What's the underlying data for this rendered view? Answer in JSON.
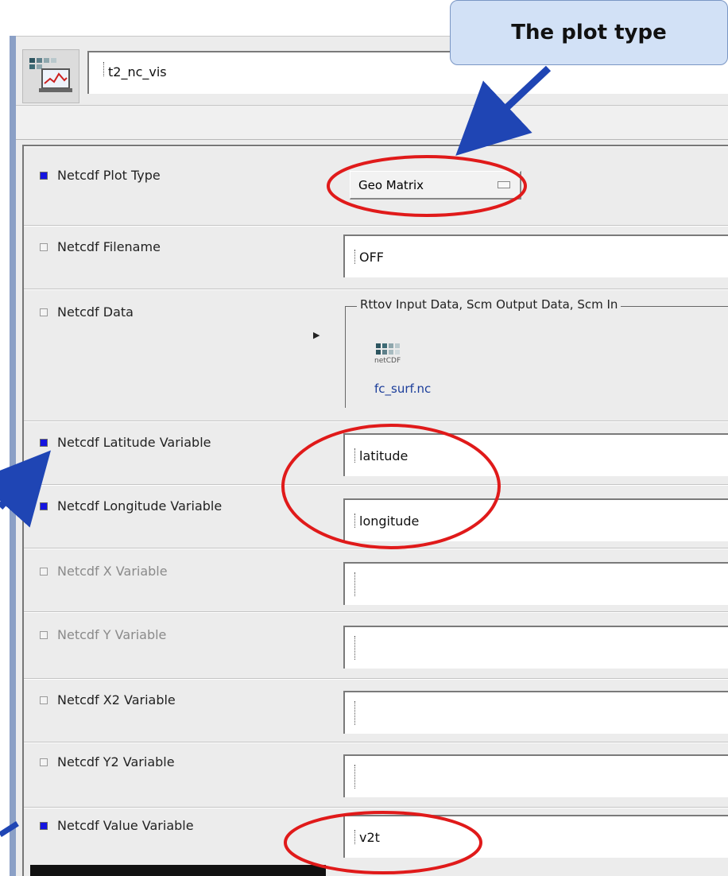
{
  "callout": {
    "text": "The plot type"
  },
  "header": {
    "name": "t2_nc_vis"
  },
  "data_box": {
    "legend": "Rttov Input Data, Scm Output Data, Scm In",
    "icon_label": "netCDF",
    "file": "fc_surf.nc"
  },
  "plot_type": {
    "value": "Geo Matrix"
  },
  "rows": [
    {
      "label": "Netcdf Plot Type",
      "checked": true,
      "enabled": true
    },
    {
      "label": "Netcdf Filename",
      "checked": false,
      "enabled": true,
      "value": "OFF"
    },
    {
      "label": "Netcdf Data",
      "checked": false,
      "enabled": true
    },
    {
      "label": "Netcdf Latitude Variable",
      "checked": true,
      "enabled": true,
      "value": "latitude"
    },
    {
      "label": "Netcdf Longitude Variable",
      "checked": true,
      "enabled": true,
      "value": "longitude"
    },
    {
      "label": "Netcdf X Variable",
      "checked": false,
      "enabled": false,
      "value": ""
    },
    {
      "label": "Netcdf Y Variable",
      "checked": false,
      "enabled": false,
      "value": ""
    },
    {
      "label": "Netcdf X2 Variable",
      "checked": false,
      "enabled": true,
      "value": ""
    },
    {
      "label": "Netcdf Y2 Variable",
      "checked": false,
      "enabled": true,
      "value": ""
    },
    {
      "label": "Netcdf Value Variable",
      "checked": true,
      "enabled": true,
      "value": "v2t"
    }
  ],
  "colors": {
    "accent": "#1414e0",
    "annotation_red": "#e01a1a",
    "arrow_blue": "#1f45b4",
    "callout_bg": "#d2e1f6"
  }
}
